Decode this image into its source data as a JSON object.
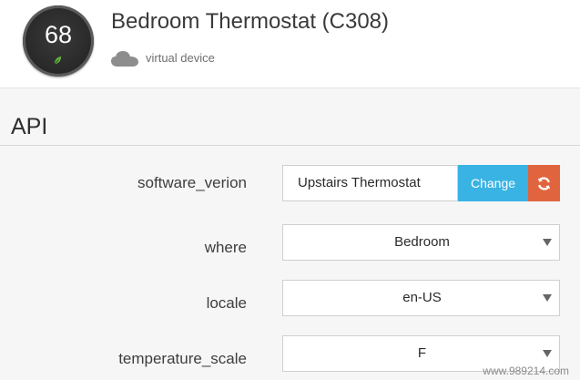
{
  "device": {
    "temperature": "68",
    "title": "Bedroom Thermostat (C308)",
    "subtitle": "virtual device",
    "dial_icon": "leaf-icon",
    "status_icon": "cloud-icon",
    "leaf_color": "#5fb33c"
  },
  "section": {
    "title": "API"
  },
  "fields": {
    "software_version": {
      "label": "software_verion",
      "value": "Upstairs Thermostat",
      "change_label": "Change",
      "refresh_icon": "refresh-icon"
    },
    "where": {
      "label": "where",
      "value": "Bedroom"
    },
    "locale": {
      "label": "locale",
      "value": "en-US"
    },
    "temperature_scale": {
      "label": "temperature_scale",
      "value": "F"
    }
  },
  "watermark": "www.989214.com",
  "colors": {
    "accent_blue": "#39b3e4",
    "accent_orange": "#e0653e"
  }
}
